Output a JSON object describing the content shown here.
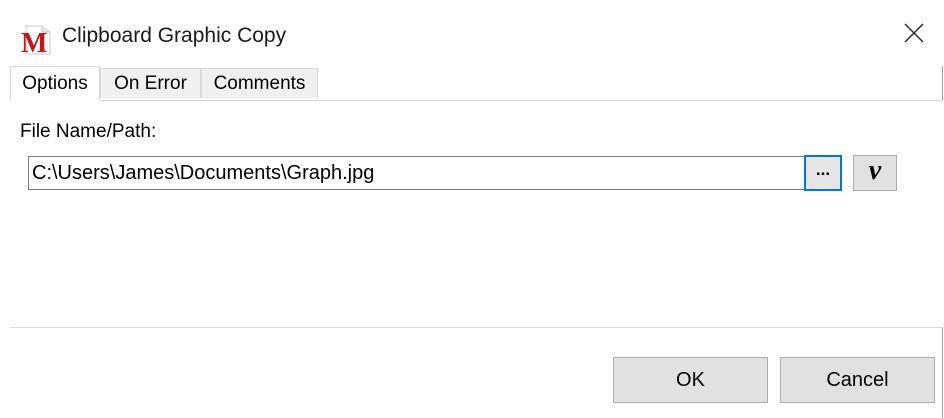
{
  "window": {
    "title": "Clipboard Graphic Copy",
    "app_icon_letter": "M",
    "app_icon_color": "#c0161c",
    "close_icon": "close-icon"
  },
  "tabs": [
    {
      "label": "Options",
      "active": true
    },
    {
      "label": "On Error",
      "active": false
    },
    {
      "label": "Comments",
      "active": false
    }
  ],
  "options": {
    "file_label": "File Name/Path:",
    "file_value": "C:\\Users\\James\\Documents\\Graph.jpg",
    "browse_label": "...",
    "variable_label": "v",
    "browse_border_color": "#0078d7"
  },
  "footer": {
    "ok_label": "OK",
    "cancel_label": "Cancel"
  }
}
